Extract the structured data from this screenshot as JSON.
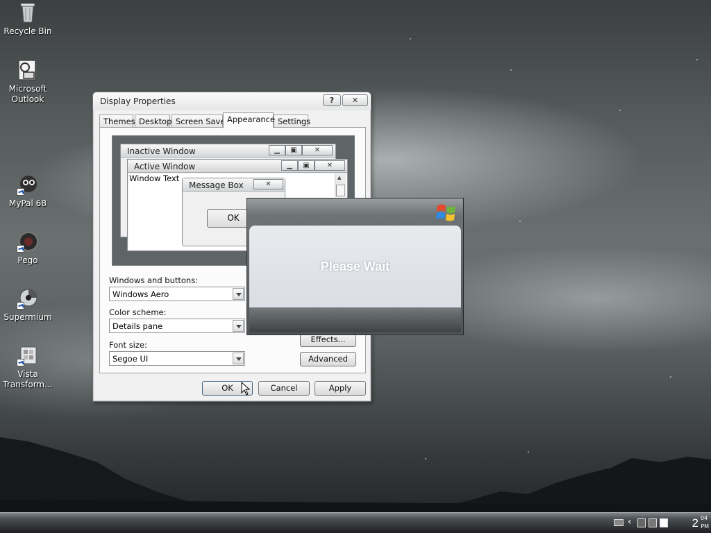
{
  "desktop": {
    "icons": [
      {
        "label": "Recycle Bin",
        "icon": "recycle-bin-icon"
      },
      {
        "label": "Microsoft Outlook",
        "icon": "outlook-icon"
      },
      {
        "label": "MyPal 68",
        "icon": "mypal-icon"
      },
      {
        "label": "Pego",
        "icon": "pego-icon"
      },
      {
        "label": "Supermium",
        "icon": "supermium-icon"
      },
      {
        "label": "Vista Transform...",
        "icon": "vista-transform-icon"
      }
    ]
  },
  "dialog": {
    "title": "Display Properties",
    "help_label": "?",
    "close_label": "✕",
    "tabs": [
      "Themes",
      "Desktop",
      "Screen Saver",
      "Appearance",
      "Settings"
    ],
    "active_tab": "Appearance",
    "preview": {
      "inactive_title": "Inactive Window",
      "active_title": "Active Window",
      "window_text": "Window Text",
      "message_box_title": "Message Box",
      "message_box_ok": "OK"
    },
    "windows_buttons_label": "Windows and buttons:",
    "windows_buttons_value": "Windows Aero",
    "color_scheme_label": "Color scheme:",
    "color_scheme_value": "Details pane",
    "font_size_label": "Font size:",
    "font_size_value": "Segoe UI",
    "effects_label": "Effects...",
    "advanced_label": "Advanced",
    "ok_label": "OK",
    "cancel_label": "Cancel",
    "apply_label": "Apply"
  },
  "wait_dialog": {
    "message": "Please Wait",
    "logo": "windows-flag-icon"
  },
  "taskbar": {
    "clock_hour": "2",
    "clock_minute": "04",
    "clock_ampm": "PM"
  },
  "colors": {
    "accent": "#5f6467",
    "wait_panel": "#dadde4"
  }
}
